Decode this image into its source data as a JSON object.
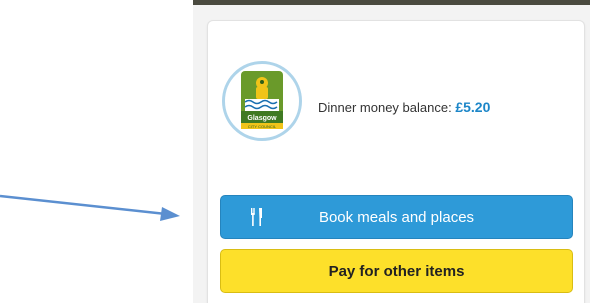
{
  "account": {
    "balance_label": "Dinner money balance:",
    "balance_value": "£5.20",
    "logo_icon": "glasgow-city-council-crest",
    "logo_text": "Glasgow CITY COUNCIL"
  },
  "actions": {
    "book_label": "Book meals and places",
    "book_icon": "cutlery-icon",
    "pay_label": "Pay for other items"
  },
  "colors": {
    "primary_blue": "#2e9ad8",
    "balance_blue": "#1c86c8",
    "pay_yellow": "#fde02a",
    "arrow_blue": "#5b8fd0"
  }
}
